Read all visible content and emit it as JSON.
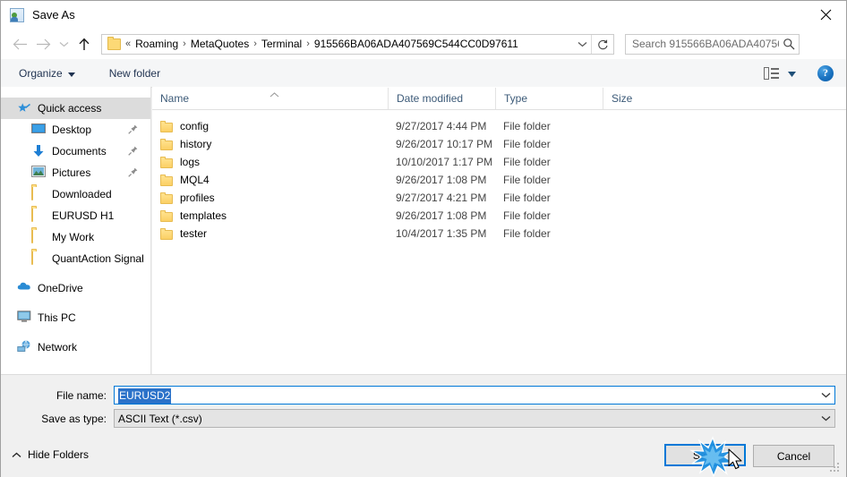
{
  "window": {
    "title": "Save As",
    "icon": "save-as-icon",
    "close_label": "✕"
  },
  "nav": {
    "back_icon": "arrow-left-icon",
    "forward_icon": "arrow-right-icon",
    "recent_icon": "chevron-down-icon",
    "up_icon": "arrow-up-icon",
    "address": {
      "folder_icon": "folder-icon",
      "overflow": "«",
      "separator": "›",
      "crumbs": [
        "Roaming",
        "MetaQuotes",
        "Terminal",
        "915566BA06ADA407569C544CC0D97611"
      ],
      "dropdown_icon": "chevron-down-icon",
      "refresh_icon": "refresh-icon"
    },
    "search": {
      "placeholder": "Search 915566BA06ADA40756...",
      "icon": "search-icon"
    }
  },
  "toolbar": {
    "organize_label": "Organize",
    "organize_caret": "▾",
    "new_folder_label": "New folder",
    "view_icon": "view-layout-icon",
    "view_caret": "▾",
    "help_label": "?",
    "help_icon": "help-icon"
  },
  "sidebar": {
    "items": [
      {
        "label": "Quick access",
        "icon": "star-pin-icon",
        "selected": true,
        "indent": false,
        "pinned": false
      },
      {
        "label": "Desktop",
        "icon": "desktop-icon",
        "selected": false,
        "indent": true,
        "pinned": true
      },
      {
        "label": "Documents",
        "icon": "documents-icon",
        "selected": false,
        "indent": true,
        "pinned": true
      },
      {
        "label": "Pictures",
        "icon": "pictures-icon",
        "selected": false,
        "indent": true,
        "pinned": true
      },
      {
        "label": "Downloaded",
        "icon": "folder-icon",
        "selected": false,
        "indent": true,
        "pinned": false
      },
      {
        "label": "EURUSD H1",
        "icon": "folder-icon",
        "selected": false,
        "indent": true,
        "pinned": false
      },
      {
        "label": "My Work",
        "icon": "folder-icon",
        "selected": false,
        "indent": true,
        "pinned": false
      },
      {
        "label": "QuantAction Signal",
        "icon": "folder-icon",
        "selected": false,
        "indent": true,
        "pinned": false
      },
      {
        "label": "OneDrive",
        "icon": "onedrive-icon",
        "selected": false,
        "indent": false,
        "pinned": false
      },
      {
        "label": "This PC",
        "icon": "this-pc-icon",
        "selected": false,
        "indent": false,
        "pinned": false
      },
      {
        "label": "Network",
        "icon": "network-icon",
        "selected": false,
        "indent": false,
        "pinned": false
      }
    ]
  },
  "filelist": {
    "columns": [
      "Name",
      "Date modified",
      "Type",
      "Size"
    ],
    "sort_indicator": "▲",
    "rows": [
      {
        "name": "config",
        "date": "9/27/2017 4:44 PM",
        "type": "File folder",
        "size": ""
      },
      {
        "name": "history",
        "date": "9/26/2017 10:17 PM",
        "type": "File folder",
        "size": ""
      },
      {
        "name": "logs",
        "date": "10/10/2017 1:17 PM",
        "type": "File folder",
        "size": ""
      },
      {
        "name": "MQL4",
        "date": "9/26/2017 1:08 PM",
        "type": "File folder",
        "size": ""
      },
      {
        "name": "profiles",
        "date": "9/27/2017 4:21 PM",
        "type": "File folder",
        "size": ""
      },
      {
        "name": "templates",
        "date": "9/26/2017 1:08 PM",
        "type": "File folder",
        "size": ""
      },
      {
        "name": "tester",
        "date": "10/4/2017 1:35 PM",
        "type": "File folder",
        "size": ""
      }
    ]
  },
  "form": {
    "file_name_label": "File name:",
    "file_name_value": "EURUSD2",
    "save_as_type_label": "Save as type:",
    "save_as_type_value": "ASCII Text (*.csv)",
    "dropdown_icon": "chevron-down-icon"
  },
  "footer": {
    "hide_folders_label": "Hide Folders",
    "hide_folders_caret": "⌃",
    "save_label": "Save",
    "cancel_label": "Cancel",
    "resize_grip": "resize-grip-icon"
  },
  "colors": {
    "accent": "#0078d7",
    "selection": "#2b72c9",
    "sidebar_selected": "#dcdcdc",
    "folder_yellow": "#fbd065",
    "header_text": "#3c5a78",
    "chrome_bg": "#f0f0f0"
  }
}
